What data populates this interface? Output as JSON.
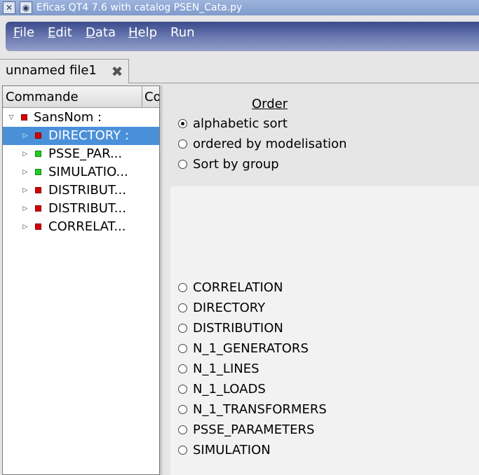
{
  "window": {
    "title": "Eficas QT4 7.6 with catalog  PSEN_Cata.py",
    "icons": [
      "app-icon",
      "window-menu-icon"
    ]
  },
  "menu": {
    "items": [
      {
        "label": "File",
        "mnemonic": "F",
        "rest": "ile"
      },
      {
        "label": "Edit",
        "mnemonic": "E",
        "rest": "dit"
      },
      {
        "label": "Data",
        "mnemonic": "D",
        "rest": "ata"
      },
      {
        "label": "Help",
        "mnemonic": "H",
        "rest": "elp"
      },
      {
        "label": "Run",
        "mnemonic": "",
        "rest": "Run"
      }
    ]
  },
  "tab": {
    "label": "unnamed file1",
    "close_icon": "close-icon"
  },
  "tree": {
    "headers": [
      "Commande",
      "Co"
    ],
    "root": {
      "label": "SansNom :",
      "color": "#d40000",
      "expanded": true
    },
    "children": [
      {
        "label": "DIRECTORY :",
        "color": "#d40000",
        "selected": true
      },
      {
        "label": "PSSE_PAR...",
        "color": "#22cc22",
        "selected": false
      },
      {
        "label": "SIMULATIO...",
        "color": "#22cc22",
        "selected": false
      },
      {
        "label": "DISTRIBUT...",
        "color": "#d40000",
        "selected": false
      },
      {
        "label": "DISTRIBUT...",
        "color": "#d40000",
        "selected": false
      },
      {
        "label": "CORRELAT...",
        "color": "#d40000",
        "selected": false
      }
    ]
  },
  "order": {
    "title": "Order",
    "options": [
      {
        "label": "alphabetic sort",
        "checked": true
      },
      {
        "label": "ordered by modelisation",
        "checked": false
      },
      {
        "label": "Sort by group",
        "checked": false
      }
    ]
  },
  "commands": [
    {
      "label": "CORRELATION",
      "checked": false
    },
    {
      "label": "DIRECTORY",
      "checked": false
    },
    {
      "label": "DISTRIBUTION",
      "checked": false
    },
    {
      "label": "N_1_GENERATORS",
      "checked": false
    },
    {
      "label": "N_1_LINES",
      "checked": false
    },
    {
      "label": "N_1_LOADS",
      "checked": false
    },
    {
      "label": "N_1_TRANSFORMERS",
      "checked": false
    },
    {
      "label": "PSSE_PARAMETERS",
      "checked": false
    },
    {
      "label": "SIMULATION",
      "checked": false
    }
  ],
  "colors": {
    "selection": "#4a90d9",
    "menubar": "#4d5d9c",
    "status_ok": "#22cc22",
    "status_error": "#d40000"
  }
}
